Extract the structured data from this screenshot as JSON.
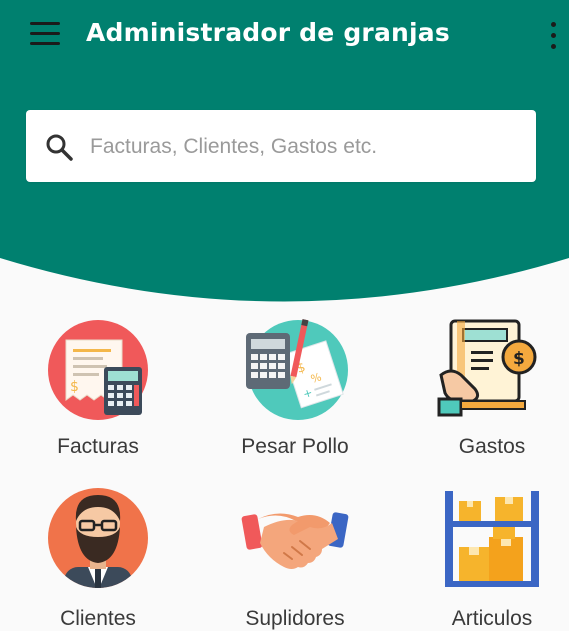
{
  "app": {
    "title": "Administrador de granjas",
    "menu_icon": "hamburger-menu-icon",
    "more_icon": "more-vertical-icon"
  },
  "colors": {
    "primary": "#00806f",
    "background": "#fafafa",
    "label": "#3a3a3a"
  },
  "search": {
    "placeholder": "Facturas, Clientes, Gastos etc.",
    "icon": "search-icon"
  },
  "modules": [
    {
      "label": "Facturas",
      "icon": "invoice-calculator-icon"
    },
    {
      "label": "Pesar Pollo",
      "icon": "calculator-document-icon"
    },
    {
      "label": "Gastos",
      "icon": "receipt-coin-icon"
    },
    {
      "label": "Clientes",
      "icon": "bearded-man-avatar-icon"
    },
    {
      "label": "Suplidores",
      "icon": "handshake-icon"
    },
    {
      "label": "Articulos",
      "icon": "shelf-boxes-icon"
    }
  ]
}
